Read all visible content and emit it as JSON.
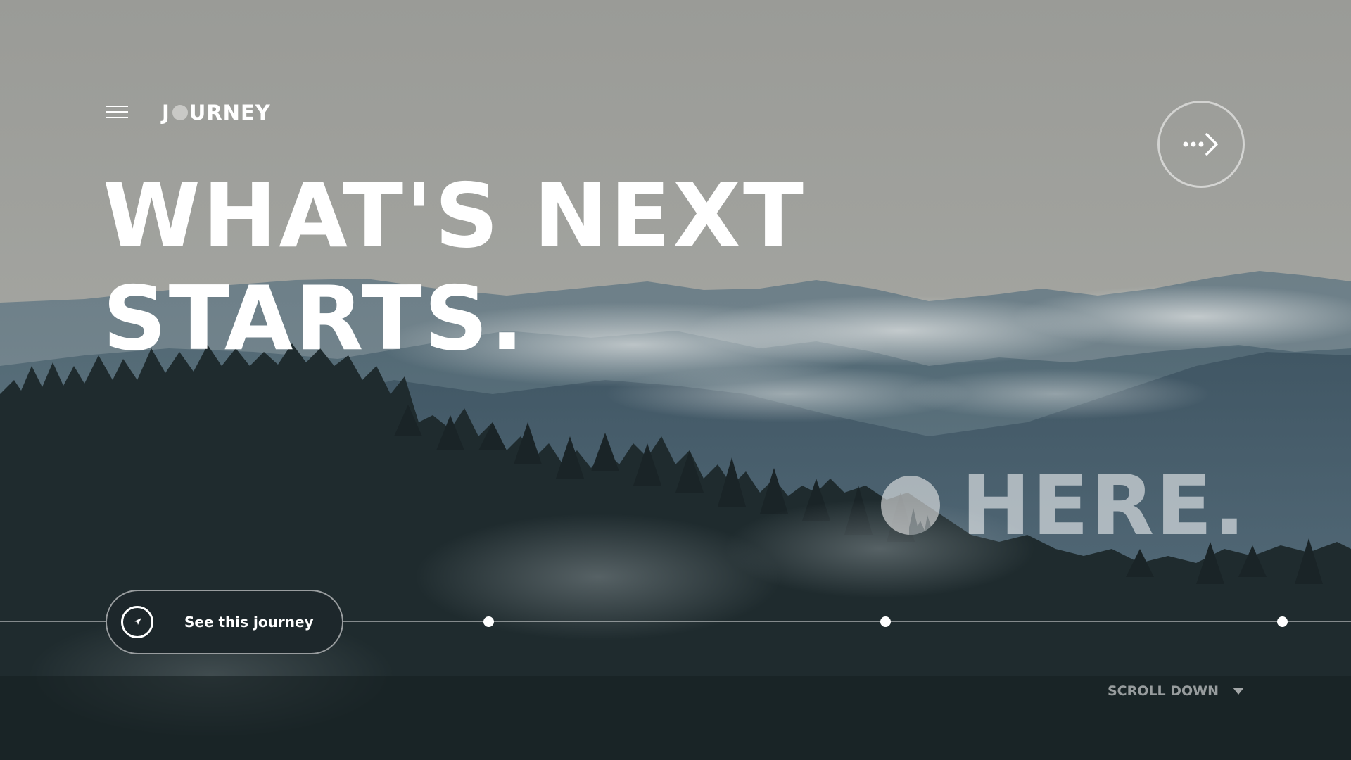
{
  "header": {
    "logo_prefix": "J",
    "logo_suffix": "URNEY",
    "menu_icon": "hamburger-icon",
    "next_icon": "dotted-arrow-right-icon"
  },
  "hero": {
    "headline_line1": "WHAT'S NEXT",
    "headline_line2": "STARTS.",
    "accent_word": "HERE."
  },
  "cta": {
    "label": "See this journey",
    "icon": "compass-icon"
  },
  "timeline": {
    "stops": 3
  },
  "scroll": {
    "label": "SCROLL DOWN",
    "icon": "caret-down-icon"
  },
  "colors": {
    "text": "#ffffff",
    "muted_text": "#b8bdbf",
    "button_bg": "#1d272b"
  }
}
